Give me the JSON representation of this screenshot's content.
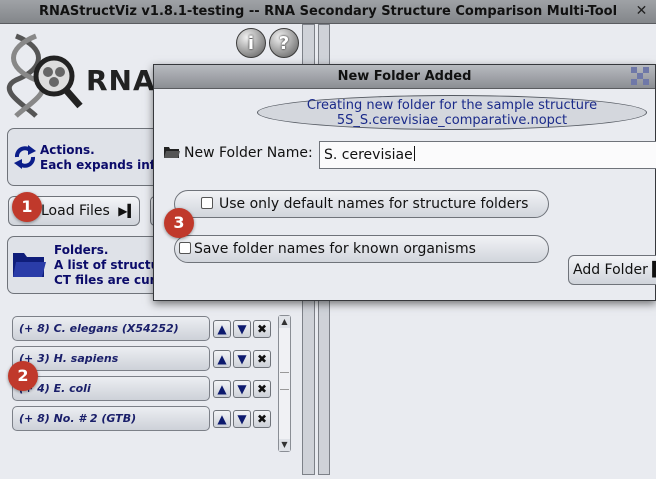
{
  "app": {
    "title": "RNAStructViz v1.8.1-testing -- RNA Secondary Structure Comparison Multi-Tool",
    "close": "✕",
    "logo_text": "RNA"
  },
  "toolbar": {
    "info_label": "i",
    "help_label": "?"
  },
  "actions_panel": {
    "line1": "Actions.",
    "line2": "Each expands inf"
  },
  "load_files": {
    "label": "Load Files"
  },
  "folders_panel": {
    "line1": "Folders.",
    "line2": "A list of structu",
    "line3": "CT files are cur"
  },
  "folders": [
    {
      "label": "(+ 8) C. elegans (X54252)"
    },
    {
      "label": "(+ 3) H. sapiens"
    },
    {
      "label": "(+ 4) E. coli"
    },
    {
      "label": "(+ 8) No. # 2 (GTB)"
    }
  ],
  "row_controls": {
    "up": "▲",
    "down": "▼",
    "remove": "✖"
  },
  "scroll": {
    "up": "▲",
    "down": "▼"
  },
  "dialog": {
    "title": "New Folder Added",
    "message_line1": "Creating new folder for the sample structure",
    "message_line2": "5S_S.cerevisiae_comparative.nopct",
    "name_label": "New Folder Name:",
    "name_value": "S. cerevisiae",
    "option_default_names": "Use only default names for structure folders",
    "option_save_names": "Save folder names for known organisms",
    "add_button": "Add Folder"
  },
  "badges": [
    "1",
    "2",
    "3"
  ],
  "colors": {
    "panel_text": "#0b0b6a",
    "badge": "#c0392b",
    "title_bar": "#8b8e93",
    "app_bg": "#e9ebf0"
  }
}
